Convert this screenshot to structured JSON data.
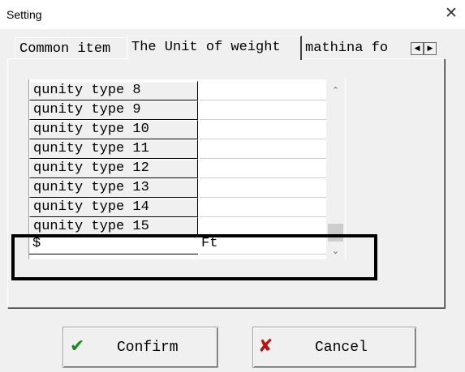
{
  "window": {
    "title": "Setting",
    "close_glyph": "✕"
  },
  "tabs": [
    {
      "label": "Common item",
      "active": false
    },
    {
      "label": "The Unit of weight",
      "active": true
    },
    {
      "label": "mathina fo",
      "active": false
    }
  ],
  "tab_scroll": {
    "left_glyph": "◀",
    "right_glyph": "▶"
  },
  "table": {
    "rows": [
      {
        "name": "qunity type 8",
        "unit": ""
      },
      {
        "name": "qunity type 9",
        "unit": ""
      },
      {
        "name": "qunity type 10",
        "unit": ""
      },
      {
        "name": "qunity type 11",
        "unit": ""
      },
      {
        "name": "qunity type 12",
        "unit": ""
      },
      {
        "name": "qunity type 13",
        "unit": ""
      },
      {
        "name": "qunity type 14",
        "unit": ""
      },
      {
        "name": "qunity type 15",
        "unit": ""
      },
      {
        "name": "$",
        "unit": "Ft"
      }
    ],
    "selected_row": 8
  },
  "scrollbar": {
    "up_glyph": "⌃",
    "down_glyph": "⌄"
  },
  "buttons": {
    "confirm": {
      "label": "Confirm",
      "icon": "check-icon",
      "icon_glyph": "✔",
      "icon_color": "#1d8a1d"
    },
    "cancel": {
      "label": "Cancel",
      "icon": "x-icon",
      "icon_glyph": "✘",
      "icon_color": "#b81414"
    }
  }
}
